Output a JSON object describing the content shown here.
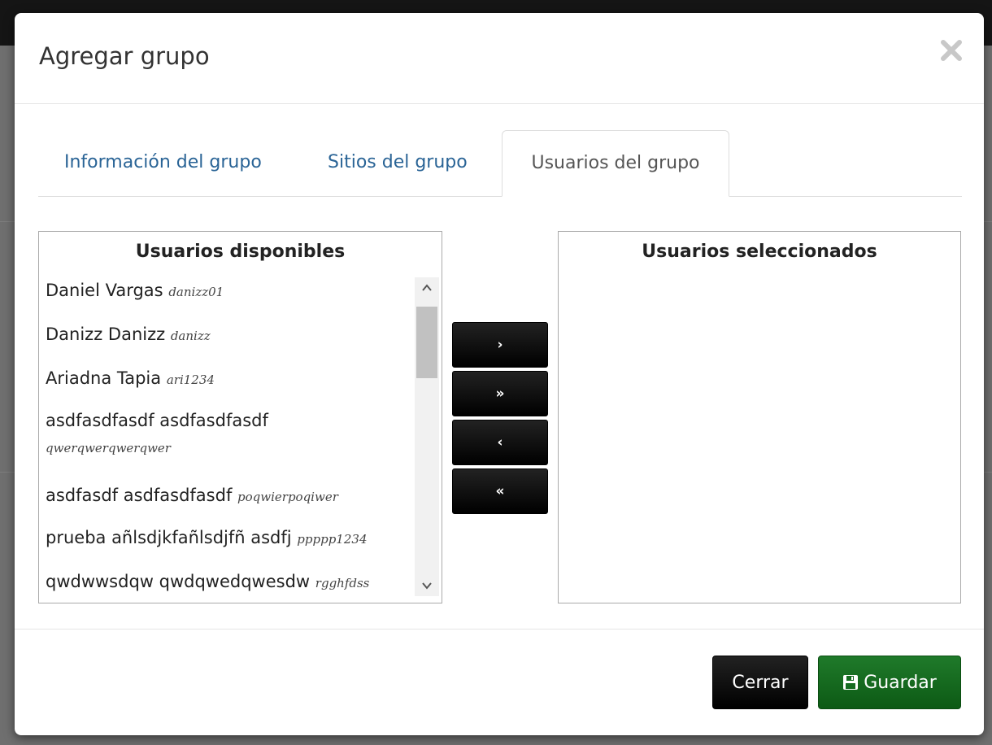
{
  "modal": {
    "title": "Agregar grupo"
  },
  "tabs": [
    {
      "label": "Información del grupo",
      "active": false
    },
    {
      "label": "Sitios del grupo",
      "active": false
    },
    {
      "label": "Usuarios del grupo",
      "active": true
    }
  ],
  "available": {
    "title": "Usuarios disponibles",
    "items": [
      {
        "name": "Daniel Vargas",
        "username": "danizz01"
      },
      {
        "name": "Danizz Danizz",
        "username": "danizz"
      },
      {
        "name": "Ariadna Tapia",
        "username": "ari1234"
      },
      {
        "name": "asdfasdfasdf asdfasdfasdf",
        "username": "qwerqwerqwerqwer"
      },
      {
        "name": "asdfasdf asdfasdfasdf",
        "username": "poqwierpoqiwer"
      },
      {
        "name": "prueba añlsdjkfañlsdjfñ asdfj",
        "username": "ppppp1234"
      },
      {
        "name": "qwdwwsdqw qwdqwedqwesdw",
        "username": "rgghfdss"
      }
    ]
  },
  "selected": {
    "title": "Usuarios seleccionados",
    "items": []
  },
  "movers": {
    "add_one": "›",
    "add_all": "»",
    "remove_one": "‹",
    "remove_all": "«"
  },
  "footer": {
    "close_label": "Cerrar",
    "save_label": "Guardar"
  },
  "colors": {
    "save_button": "#1f7a2a",
    "dark_button": "#000000",
    "tab_link": "#2a6496"
  },
  "icons": {
    "close": "close-icon",
    "save": "floppy-disk-icon",
    "scroll_up": "chevron-up-icon",
    "scroll_down": "chevron-down-icon"
  }
}
